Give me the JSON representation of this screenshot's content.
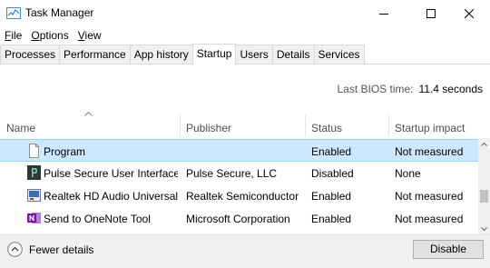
{
  "window": {
    "title": "Task Manager"
  },
  "menu": {
    "items": [
      {
        "accel": "F",
        "rest": "ile"
      },
      {
        "accel": "O",
        "rest": "ptions"
      },
      {
        "accel": "V",
        "rest": "iew"
      }
    ]
  },
  "tabs": [
    "Processes",
    "Performance",
    "App history",
    "Startup",
    "Users",
    "Details",
    "Services"
  ],
  "active_tab": "Startup",
  "bios": {
    "label": "Last BIOS time:",
    "value": "11.4 seconds"
  },
  "table": {
    "columns": [
      "Name",
      "Publisher",
      "Status",
      "Startup impact"
    ],
    "rows": [
      {
        "icon": "blank-file-icon",
        "name": "Program",
        "publisher": "",
        "status": "Enabled",
        "impact": "Not measured",
        "selected": true
      },
      {
        "icon": "pulse-secure-icon",
        "name": "Pulse Secure User Interface",
        "publisher": "Pulse Secure, LLC",
        "status": "Disabled",
        "impact": "None",
        "selected": false
      },
      {
        "icon": "realtek-audio-icon",
        "name": "Realtek HD Audio Universal ...",
        "publisher": "Realtek Semiconductor",
        "status": "Enabled",
        "impact": "Not measured",
        "selected": false
      },
      {
        "icon": "onenote-icon",
        "name": "Send to OneNote Tool",
        "publisher": "Microsoft Corporation",
        "status": "Enabled",
        "impact": "Not measured",
        "selected": false
      }
    ]
  },
  "footer": {
    "fewer_details": "Fewer details",
    "disable_accel": "D",
    "disable_prefix": "Dis",
    "disable_suffix": "able"
  },
  "colors": {
    "selection": "#cce8ff",
    "selection_border": "#99d1ff",
    "footer_bg": "#f0f0f0"
  }
}
